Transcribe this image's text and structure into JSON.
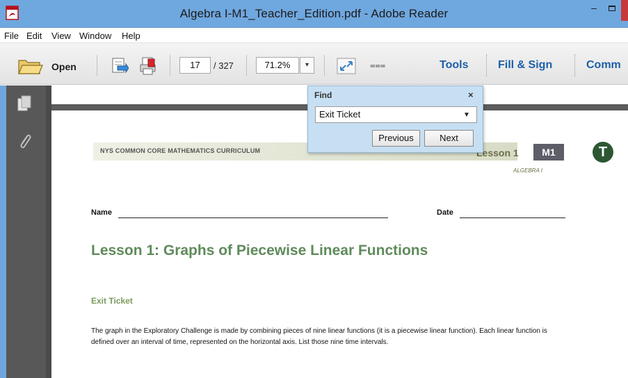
{
  "window": {
    "title": "Algebra I-M1_Teacher_Edition.pdf - Adobe Reader",
    "minimize_glyph": "–"
  },
  "menu": {
    "items": [
      "File",
      "Edit",
      "View",
      "Window",
      "Help"
    ]
  },
  "toolbar": {
    "open_label": "Open",
    "current_page": "17",
    "total_pages": "/ 327",
    "zoom": "71.2%",
    "dropdown_glyph": "▾",
    "more_glyph": "⩶",
    "tabs": [
      "Tools",
      "Fill & Sign",
      "Comm"
    ]
  },
  "find_panel": {
    "title": "Find",
    "close_glyph": "×",
    "query": "Exit Ticket",
    "arrow_glyph": "▼",
    "previous_label": "Previous",
    "next_label": "Next"
  },
  "document": {
    "curriculum_header": "NYS COMMON CORE MATHEMATICS CURRICULUM",
    "lesson_tag": "Lesson 1",
    "module_tag": "M1",
    "course_tag": "ALGEBRA I",
    "logo_letter": "T",
    "name_label": "Name",
    "date_label": "Date",
    "lesson_title": "Lesson 1:  Graphs of Piecewise Linear Functions",
    "exit_ticket_heading": "Exit Ticket",
    "body_text": "The graph in the Exploratory Challenge is made by combining pieces of nine linear functions (it is a piecewise linear function).  Each linear function is defined over an interval of time, represented on the horizontal axis.  List those nine time intervals."
  },
  "colors": {
    "titlebar": "#6fa7df",
    "tab_text": "#1c5fa8",
    "lesson_title": "#5f8b5b",
    "find_panel_bg": "#c7dff2",
    "left_panel": "#585858"
  },
  "icons": {
    "app": "adobe-reader-icon",
    "open": "folder-icon",
    "save": "save-download-icon",
    "print": "print-icon",
    "fit": "expand-arrows-icon",
    "pages": "pages-thumbnail-icon",
    "attach": "paperclip-icon"
  }
}
